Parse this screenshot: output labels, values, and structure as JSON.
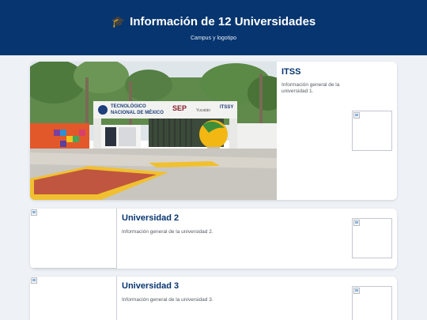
{
  "header": {
    "title": "Información de 12 Universidades",
    "subtitle": "Campus y logotipo",
    "icon": "graduation-cap-icon"
  },
  "universities": [
    {
      "name": "ITSS",
      "description": "Información general de la universidad 1.",
      "campus_sign": {
        "line1": "TECNOLÓGICO",
        "line2": "NACIONAL DE MÉXICO",
        "sep": "SEP",
        "yucatan": "Yucatán",
        "itssy": "ITSSY"
      }
    },
    {
      "name": "Universidad 2",
      "description": "Información general de la universidad 2."
    },
    {
      "name": "Universidad 3",
      "description": "Información general de la universidad 3."
    }
  ],
  "colors": {
    "header_bg": "#06356f",
    "title": "#06356f",
    "page_bg": "#eef1f5"
  }
}
